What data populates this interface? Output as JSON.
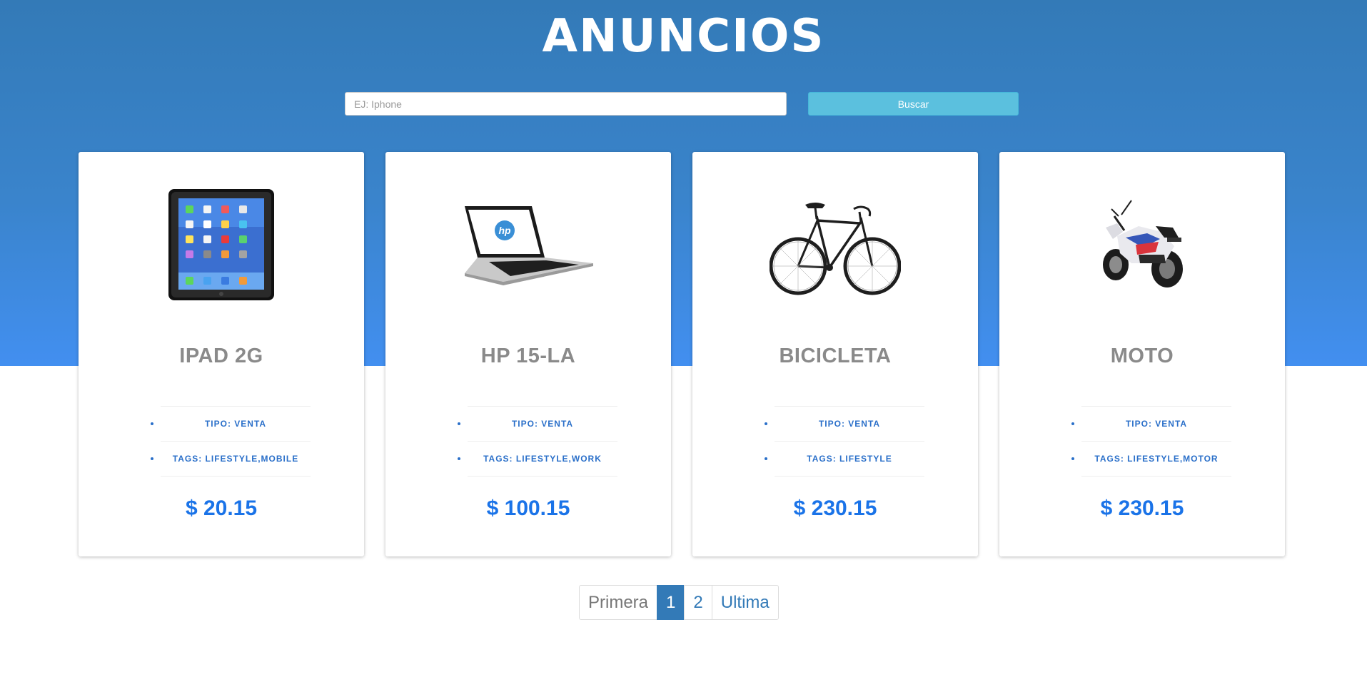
{
  "header": {
    "title": "ANUNCIOS"
  },
  "search": {
    "placeholder": "EJ: Iphone",
    "value": "",
    "button_label": "Buscar"
  },
  "cards": [
    {
      "title": "IPAD 2G",
      "image_icon": "ipad-image",
      "tipo": "TIPO: VENTA",
      "tags": "TAGS: LIFESTYLE,MOBILE",
      "price": "$ 20.15"
    },
    {
      "title": "HP 15-LA",
      "image_icon": "laptop-image",
      "tipo": "TIPO: VENTA",
      "tags": "TAGS: LIFESTYLE,WORK",
      "price": "$ 100.15"
    },
    {
      "title": "BICICLETA",
      "image_icon": "bicycle-image",
      "tipo": "TIPO: VENTA",
      "tags": "TAGS: LIFESTYLE",
      "price": "$ 230.15"
    },
    {
      "title": "MOTO",
      "image_icon": "motorcycle-image",
      "tipo": "TIPO: VENTA",
      "tags": "TAGS: LIFESTYLE,MOTOR",
      "price": "$ 230.15"
    }
  ],
  "pagination": {
    "first": "Primera",
    "pages": [
      "1",
      "2"
    ],
    "active_page": "1",
    "last": "Ultima"
  },
  "colors": {
    "hero_top": "#337ab7",
    "hero_bottom": "#428ff0",
    "button": "#5bc0de",
    "price": "#1a73e8",
    "title_gray": "#8a8a8a"
  }
}
